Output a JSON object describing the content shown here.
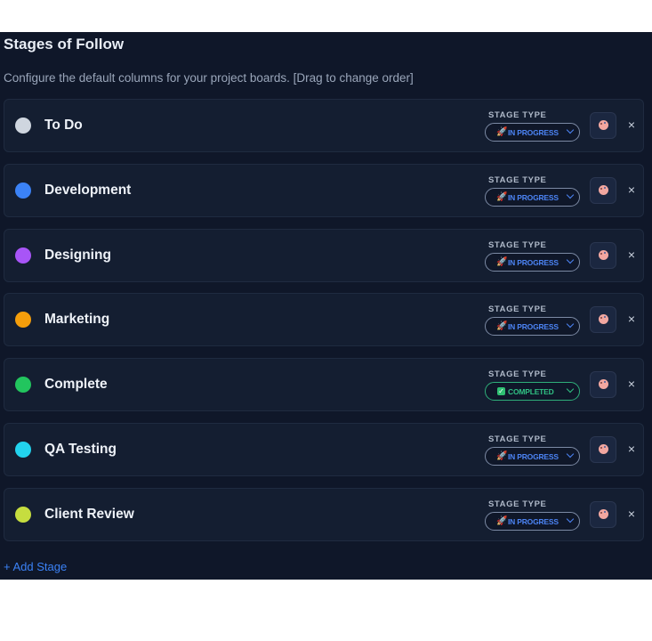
{
  "header": {
    "title": "Stages of Follow",
    "subtitle": "Configure the default columns for your project boards. [Drag to change order]"
  },
  "stage_type_label": "STAGE TYPE",
  "stages": [
    {
      "name": "To Do",
      "color": "#cfd6df",
      "type": "IN PROGRESS",
      "status": "inprogress"
    },
    {
      "name": "Development",
      "color": "#3b82f6",
      "type": "IN PROGRESS",
      "status": "inprogress"
    },
    {
      "name": "Designing",
      "color": "#a855f7",
      "type": "IN PROGRESS",
      "status": "inprogress"
    },
    {
      "name": "Marketing",
      "color": "#f59e0b",
      "type": "IN PROGRESS",
      "status": "inprogress"
    },
    {
      "name": "Complete",
      "color": "#22c55e",
      "type": "COMPLETED",
      "status": "completed"
    },
    {
      "name": "QA Testing",
      "color": "#22d3ee",
      "type": "IN PROGRESS",
      "status": "inprogress"
    },
    {
      "name": "Client Review",
      "color": "#c6dd3f",
      "type": "IN PROGRESS",
      "status": "inprogress"
    }
  ],
  "icons": {
    "inprogress": "rocket-icon",
    "completed": "checkbox-icon",
    "color_picker": "palette-icon",
    "remove": "close-icon"
  },
  "remove_glyph": "×",
  "add_stage_label": "+ Add Stage"
}
